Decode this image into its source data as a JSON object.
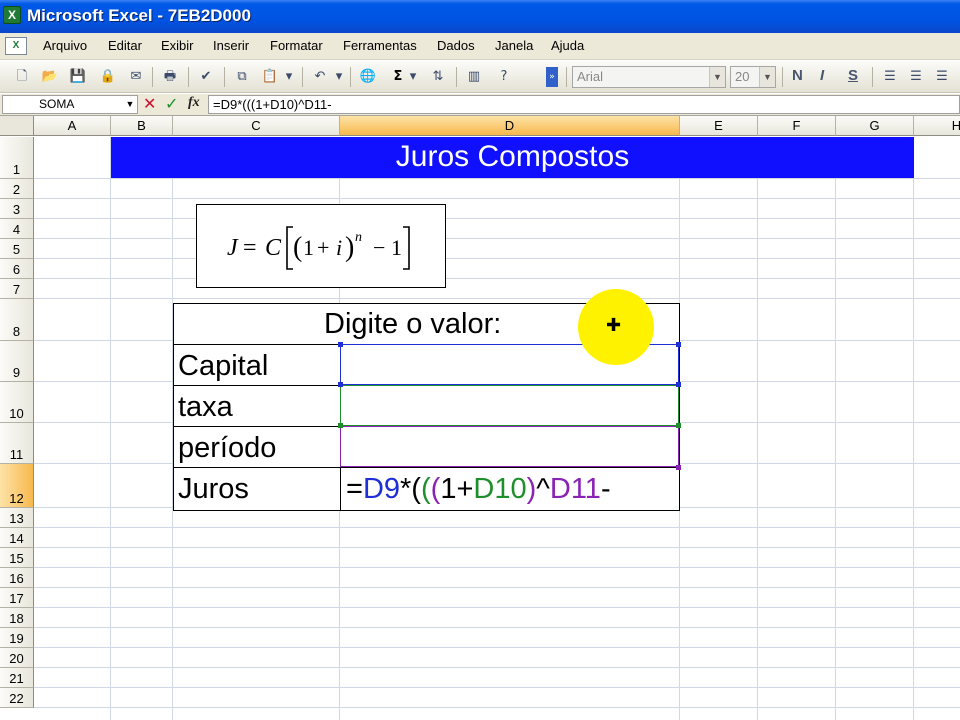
{
  "window": {
    "title": "Microsoft Excel - 7EB2D000",
    "app_icon_glyph": "X"
  },
  "menu": {
    "doc_icon_glyph": "X",
    "items": [
      "Arquivo",
      "Editar",
      "Exibir",
      "Inserir",
      "Formatar",
      "Ferramentas",
      "Dados",
      "Janela",
      "Ajuda"
    ]
  },
  "toolbar": {
    "font_name": "Arial",
    "font_size": "20",
    "sum_glyph": "Σ",
    "bold_label": "N",
    "italic_label": "I",
    "underline_label": "S"
  },
  "formula_bar": {
    "name_box": "SOMA",
    "formula": "=D9*(((1+D10)^D11-"
  },
  "sheet": {
    "columns": [
      "A",
      "B",
      "C",
      "D",
      "E",
      "F",
      "G",
      "H"
    ],
    "rows": [
      "1",
      "2",
      "3",
      "4",
      "5",
      "6",
      "7",
      "8",
      "9",
      "10",
      "11",
      "12",
      "13",
      "14",
      "15",
      "16",
      "17",
      "18",
      "19",
      "20",
      "21",
      "22"
    ],
    "active_column": "D",
    "active_row": "12",
    "banner_title": "Juros Compostos",
    "formula_image_alt": "J = C[(1+i)^n − 1]",
    "prompt_header": "Digite o valor:",
    "labels": {
      "capital": "Capital",
      "taxa": "taxa",
      "periodo": "período",
      "juros": "Juros"
    },
    "editing_formula": {
      "parts": [
        {
          "text": "=",
          "color": "#000000"
        },
        {
          "text": "D9",
          "color": "#1f2fd6"
        },
        {
          "text": "*(",
          "color": "#000000"
        },
        {
          "text": "(",
          "color": "#1f8f2c"
        },
        {
          "text": "(",
          "color": "#8a22b3"
        },
        {
          "text": "1+",
          "color": "#000000"
        },
        {
          "text": "D10",
          "color": "#1f8f2c"
        },
        {
          "text": ")",
          "color": "#8a22b3"
        },
        {
          "text": "^",
          "color": "#000000"
        },
        {
          "text": "D11",
          "color": "#8a22b3"
        },
        {
          "text": "-",
          "color": "#000000"
        }
      ]
    },
    "ref_colors": {
      "D9": "#1f2fd6",
      "D10": "#1f8f2c",
      "D11": "#8a22b3"
    }
  },
  "colors": {
    "banner": "#1010ff",
    "cursor_highlight": "#fff200",
    "active_header": "#f8b84e"
  }
}
